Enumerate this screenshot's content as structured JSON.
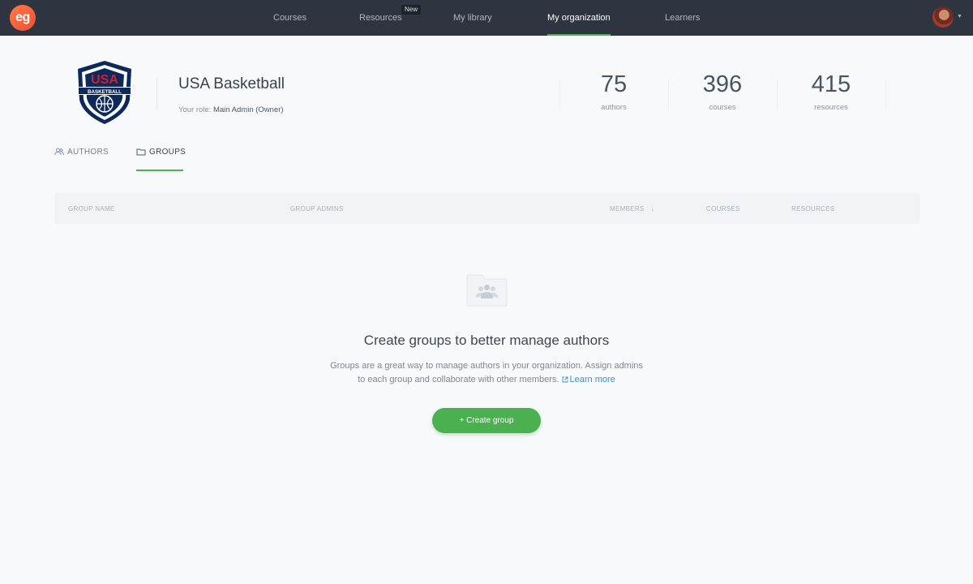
{
  "brand": {
    "logo_text": "eg",
    "accent": "#4caf50",
    "nav_bg": "#2f3540"
  },
  "nav": {
    "courses": "Courses",
    "resources": "Resources",
    "new_badge": "New",
    "my_library": "My library",
    "my_organization": "My organization",
    "learners": "Learners",
    "active": "My organization"
  },
  "org": {
    "logo_top_text": "USA",
    "logo_band_text": "BASKETBALL",
    "name": "USA Basketball",
    "role_label": "Your role:",
    "role_value": "Main Admin (Owner)"
  },
  "stats": [
    {
      "value": "75",
      "label": "authors"
    },
    {
      "value": "396",
      "label": "courses"
    },
    {
      "value": "415",
      "label": "resources"
    }
  ],
  "tabs": {
    "authors": "AUTHORS",
    "groups": "GROUPS",
    "active": "GROUPS"
  },
  "table": {
    "col_group_name": "GROUP NAME",
    "col_group_admins": "GROUP ADMINS",
    "col_members": "MEMBERS",
    "col_courses": "COURSES",
    "col_resources": "RESOURCES",
    "sort_icon": "arrow-down-icon"
  },
  "empty_state": {
    "icon": "folder-users-icon",
    "title": "Create groups to better manage authors",
    "desc_line1": "Groups are a great way to manage authors in your organization. Assign admins",
    "desc_line2": "to each group and collaborate with other members.",
    "learn_more": "Learn more",
    "button_label": "+ Create group"
  }
}
